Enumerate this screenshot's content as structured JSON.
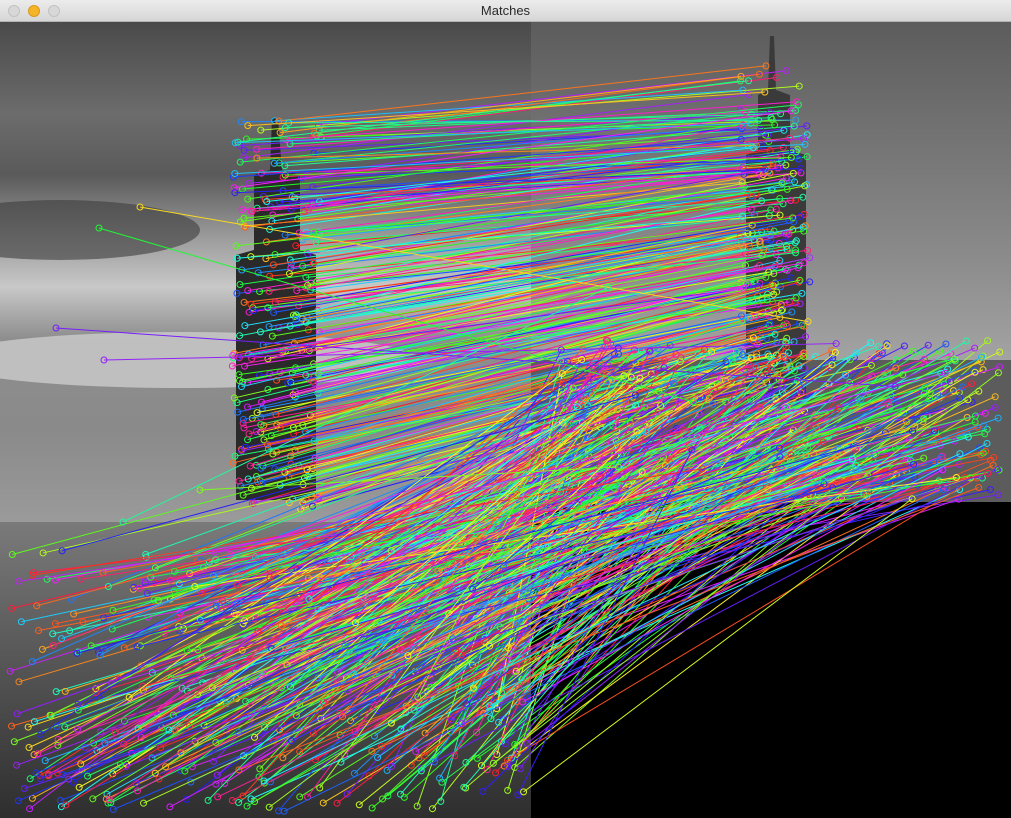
{
  "window": {
    "title": "Matches"
  },
  "colors": {
    "titlebar": "#e3e3e3",
    "minimize": "#f5b427",
    "background": "#000000"
  }
}
